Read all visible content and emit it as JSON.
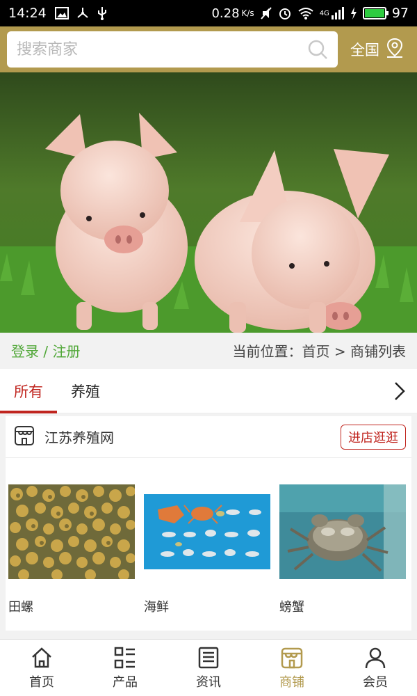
{
  "status_bar": {
    "time": "14:24",
    "network_speed": "0.28",
    "network_speed_unit": "K/s",
    "signal_label": "4G",
    "battery_level": "97"
  },
  "header": {
    "search_placeholder": "搜索商家",
    "region_label": "全国"
  },
  "breadcrumb": {
    "login": "登录",
    "separator": " / ",
    "register": "注册",
    "location_prefix": "当前位置：",
    "home": "首页",
    "arrow": " > ",
    "current": "商铺列表"
  },
  "tabs": [
    {
      "label": "所有",
      "active": true
    },
    {
      "label": "养殖",
      "active": false
    }
  ],
  "shop": {
    "name": "江苏养殖网",
    "visit_label": "进店逛逛",
    "products": [
      {
        "name": "田螺"
      },
      {
        "name": "海鲜"
      },
      {
        "name": "螃蟹"
      }
    ]
  },
  "bottom_nav": [
    {
      "label": "首页",
      "icon": "home-icon",
      "active": false
    },
    {
      "label": "产品",
      "icon": "list-icon",
      "active": false
    },
    {
      "label": "资讯",
      "icon": "news-icon",
      "active": false
    },
    {
      "label": "商铺",
      "icon": "shop-icon",
      "active": true
    },
    {
      "label": "会员",
      "icon": "user-icon",
      "active": false
    }
  ],
  "colors": {
    "header_bg": "#b29a4e",
    "accent_red": "#c0251f",
    "login_green": "#52a83a",
    "active_nav": "#b29a4e"
  }
}
